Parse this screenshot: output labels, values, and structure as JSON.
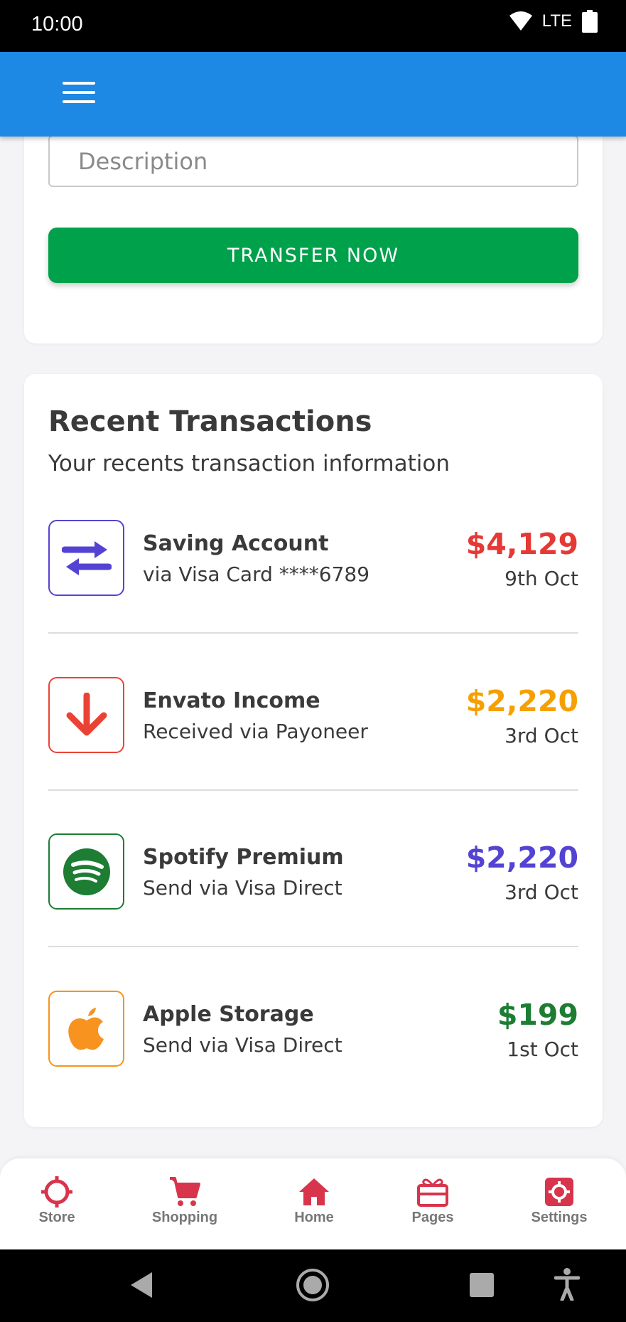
{
  "status_bar": {
    "time": "10:00",
    "network": "LTE"
  },
  "transfer": {
    "description_placeholder": "Description",
    "transfer_button": "TRANSFER NOW"
  },
  "recent": {
    "title": "Recent Transactions",
    "subtitle": "Your recents transaction information",
    "items": [
      {
        "name": "Saving Account",
        "via": "via Visa Card ****6789",
        "amount": "$4,129",
        "date": "9th Oct",
        "icon": "transfer-arrows-icon",
        "color": "#e53935",
        "icon_color": "#5443d3"
      },
      {
        "name": "Envato Income",
        "via": "Received via Payoneer",
        "amount": "$2,220",
        "date": "3rd Oct",
        "icon": "arrow-down-icon",
        "color": "#f5a000",
        "icon_color": "#ea4335"
      },
      {
        "name": "Spotify Premium",
        "via": "Send via Visa Direct",
        "amount": "$2,220",
        "date": "3rd Oct",
        "icon": "spotify-icon",
        "color": "#5443d3",
        "icon_color": "#1d7d33"
      },
      {
        "name": "Apple Storage",
        "via": "Send via Visa Direct",
        "amount": "$199",
        "date": "1st Oct",
        "icon": "apple-icon",
        "color": "#1d7d33",
        "icon_color": "#f7931e"
      }
    ]
  },
  "bottom_nav": {
    "items": [
      {
        "label": "Store",
        "icon": "crosshair-icon"
      },
      {
        "label": "Shopping",
        "icon": "cart-icon"
      },
      {
        "label": "Home",
        "icon": "home-icon"
      },
      {
        "label": "Pages",
        "icon": "gift-icon"
      },
      {
        "label": "Settings",
        "icon": "gear-icon"
      }
    ],
    "accent": "#d8344c"
  }
}
